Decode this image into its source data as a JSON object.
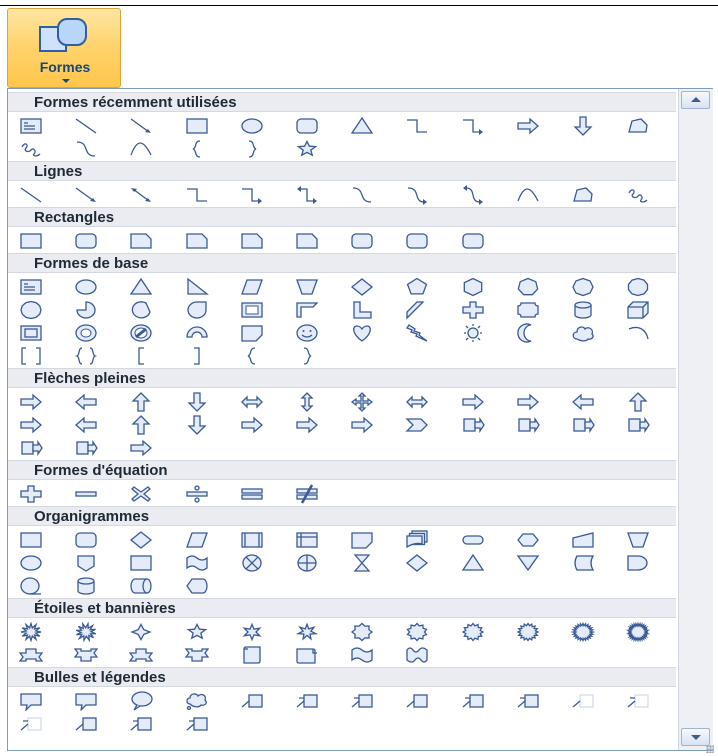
{
  "ribbon_button": {
    "label": "Formes",
    "icon": "shapes-icon"
  },
  "colors": {
    "shape_stroke": "#3a5a95",
    "shape_fill": "#e3ecf8",
    "header_bg": "#eaecf1",
    "button_bg": "#ffd46f"
  },
  "sections": [
    {
      "title": "Formes récemment utilisées",
      "rows": [
        [
          "text-box",
          "line",
          "arrow-line",
          "rectangle",
          "oval",
          "rounded-rectangle",
          "triangle",
          "elbow-connector",
          "elbow-arrow-connector",
          "right-arrow",
          "down-arrow",
          "freeform"
        ],
        [
          "scribble",
          "curved-connector",
          "curve",
          "left-brace",
          "right-brace",
          "star-5"
        ]
      ]
    },
    {
      "title": "Lignes",
      "rows": [
        [
          "line",
          "arrow-line",
          "double-arrow-line",
          "elbow-connector",
          "elbow-arrow-connector",
          "elbow-double-arrow-connector",
          "curved-connector",
          "curved-arrow-connector",
          "curved-double-arrow-connector",
          "curve",
          "freeform",
          "scribble"
        ]
      ]
    },
    {
      "title": "Rectangles",
      "rows": [
        [
          "rectangle",
          "rounded-rectangle",
          "snip-single-corner",
          "snip-same-side",
          "snip-diagonal",
          "snip-round-single",
          "round-single-corner",
          "round-same-side",
          "round-diagonal"
        ]
      ]
    },
    {
      "title": "Formes de base",
      "rows": [
        [
          "text-box",
          "oval",
          "triangle",
          "right-triangle",
          "parallelogram",
          "trapezoid",
          "diamond",
          "pentagon",
          "hexagon",
          "heptagon",
          "octagon",
          "decagon"
        ],
        [
          "dodecagon",
          "pie",
          "chord",
          "teardrop",
          "frame",
          "half-frame",
          "l-shape",
          "diagonal-stripe",
          "cross",
          "plaque",
          "can",
          "cube"
        ],
        [
          "bevel",
          "donut",
          "no-symbol",
          "block-arc",
          "folded-corner",
          "smiley-face",
          "heart",
          "lightning-bolt",
          "sun",
          "moon",
          "cloud",
          "arc"
        ],
        [
          "double-bracket",
          "double-brace",
          "left-bracket",
          "right-bracket",
          "left-brace",
          "right-brace"
        ]
      ]
    },
    {
      "title": "Flèches pleines",
      "rows": [
        [
          "right-arrow",
          "left-arrow",
          "up-arrow",
          "down-arrow",
          "left-right-arrow",
          "up-down-arrow",
          "quad-arrow",
          "left-right-up-arrow",
          "bent-arrow",
          "u-turn-arrow",
          "left-up-arrow",
          "bent-up-arrow"
        ],
        [
          "curved-right-arrow",
          "curved-left-arrow",
          "curved-up-arrow",
          "curved-down-arrow",
          "striped-right-arrow",
          "notched-right-arrow",
          "pentagon-arrow",
          "chevron",
          "right-arrow-callout",
          "down-arrow-callout",
          "left-arrow-callout",
          "up-arrow-callout"
        ],
        [
          "left-right-arrow-callout",
          "quad-arrow-callout",
          "circular-arrow"
        ]
      ]
    },
    {
      "title": "Formes d'équation",
      "rows": [
        [
          "plus",
          "minus",
          "multiply",
          "division",
          "equal",
          "not-equal"
        ]
      ]
    },
    {
      "title": "Organigrammes",
      "rows": [
        [
          "process",
          "alternate-process",
          "decision",
          "data",
          "predefined-process",
          "internal-storage",
          "document",
          "multidocument",
          "terminator",
          "preparation",
          "manual-input",
          "manual-operation"
        ],
        [
          "connector",
          "off-page-connector",
          "card",
          "punched-tape",
          "summing-junction",
          "or",
          "collate",
          "sort",
          "extract",
          "merge",
          "stored-data",
          "delay"
        ],
        [
          "sequential-access-storage",
          "magnetic-disk",
          "direct-access-storage",
          "display"
        ]
      ]
    },
    {
      "title": "Étoiles et bannières",
      "rows": [
        [
          "explosion-1",
          "explosion-2",
          "star-4",
          "star-5",
          "star-6",
          "star-7",
          "star-8",
          "star-10",
          "star-12",
          "star-16",
          "star-24",
          "star-32"
        ],
        [
          "up-ribbon",
          "down-ribbon",
          "curved-up-ribbon",
          "curved-down-ribbon",
          "vertical-scroll",
          "horizontal-scroll",
          "wave",
          "double-wave"
        ]
      ]
    },
    {
      "title": "Bulles et légendes",
      "rows": [
        [
          "rectangular-callout",
          "rounded-rectangular-callout",
          "oval-callout",
          "cloud-callout",
          "line-callout-1",
          "line-callout-2",
          "line-callout-3",
          "line-callout-1-accent",
          "line-callout-2-accent",
          "line-callout-3-accent",
          "line-callout-1-no-border",
          "line-callout-2-no-border"
        ],
        [
          "line-callout-3-no-border",
          "line-callout-1-border-accent",
          "line-callout-2-border-accent",
          "line-callout-3-border-accent"
        ]
      ]
    }
  ]
}
